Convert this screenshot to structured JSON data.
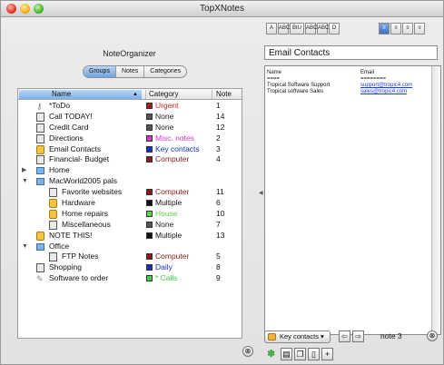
{
  "window": {
    "title": "TopXNotes"
  },
  "left": {
    "app_name": "NoteOrganizer",
    "tabs": [
      "Groups",
      "Notes",
      "Categories"
    ],
    "active_tab": "Groups",
    "columns": {
      "name": "Name",
      "category": "Category",
      "note": "Note"
    },
    "rows": [
      {
        "indent": 0,
        "tri": "",
        "icon": "key-icon",
        "label": "*ToDo",
        "category": "Urgent",
        "cat_color": "#9b1d1d",
        "cat_text_color": "#c0282d",
        "note": "1"
      },
      {
        "indent": 0,
        "tri": "",
        "icon": "note-icon",
        "label": "Call TODAY!",
        "category": "None",
        "cat_color": "#555555",
        "cat_text_color": "#222222",
        "note": "14"
      },
      {
        "indent": 0,
        "tri": "",
        "icon": "note-icon",
        "label": "Credit Card",
        "category": "None",
        "cat_color": "#555555",
        "cat_text_color": "#222222",
        "note": "12"
      },
      {
        "indent": 0,
        "tri": "",
        "icon": "note-icon",
        "label": "Directions",
        "category": "Misc. notes",
        "cat_color": "#d238c4",
        "cat_text_color": "#d238c4",
        "note": "2"
      },
      {
        "indent": 0,
        "tri": "",
        "icon": "flag-icon",
        "label": "Email Contacts",
        "category": "Key contacts",
        "cat_color": "#1b2fb8",
        "cat_text_color": "#1b2fb8",
        "note": "3"
      },
      {
        "indent": 0,
        "tri": "",
        "icon": "note-icon",
        "label": "Financial- Budget",
        "category": "Computer",
        "cat_color": "#8a1a1a",
        "cat_text_color": "#8a1a1a",
        "note": "4"
      },
      {
        "indent": 0,
        "tri": "▶",
        "icon": "folder-icon",
        "label": "Home",
        "category": "",
        "cat_color": "",
        "cat_text_color": "",
        "note": ""
      },
      {
        "indent": 0,
        "tri": "▼",
        "icon": "folder-icon",
        "label": "MacWorld2005 pals",
        "category": "",
        "cat_color": "",
        "cat_text_color": "",
        "note": ""
      },
      {
        "indent": 1,
        "tri": "",
        "icon": "note-icon",
        "label": "Favorite websites",
        "category": "Computer",
        "cat_color": "#8a1a1a",
        "cat_text_color": "#8a1a1a",
        "note": "11"
      },
      {
        "indent": 1,
        "tri": "",
        "icon": "flag-icon",
        "label": "Hardware",
        "category": "Multiple",
        "cat_color": "#111111",
        "cat_text_color": "#111111",
        "note": "6"
      },
      {
        "indent": 1,
        "tri": "",
        "icon": "flag-icon",
        "label": "Home repairs",
        "category": "House",
        "cat_color": "#5fd146",
        "cat_text_color": "#5fd146",
        "note": "10"
      },
      {
        "indent": 1,
        "tri": "",
        "icon": "note-icon",
        "label": "Miscellaneous",
        "category": "None",
        "cat_color": "#555555",
        "cat_text_color": "#222222",
        "note": "7"
      },
      {
        "indent": 0,
        "tri": "",
        "icon": "flag-icon",
        "label": "NOTE THIS!",
        "category": "Multiple",
        "cat_color": "#111111",
        "cat_text_color": "#111111",
        "note": "13"
      },
      {
        "indent": 0,
        "tri": "▼",
        "icon": "folder-icon",
        "label": "Office",
        "category": "",
        "cat_color": "",
        "cat_text_color": "",
        "note": ""
      },
      {
        "indent": 1,
        "tri": "",
        "icon": "note-icon",
        "label": "FTP Notes",
        "category": "Computer",
        "cat_color": "#8a1a1a",
        "cat_text_color": "#8a1a1a",
        "note": "5"
      },
      {
        "indent": 0,
        "tri": "",
        "icon": "note-icon",
        "label": "Shopping",
        "category": "Daily",
        "cat_color": "#1b2fb8",
        "cat_text_color": "#1b2fb8",
        "note": "8"
      },
      {
        "indent": 0,
        "tri": "",
        "icon": "pen-icon",
        "label": "Software to order",
        "category": "* Calls",
        "cat_color": "#3ecf4a",
        "cat_text_color": "#3ecf4a",
        "note": "9"
      }
    ]
  },
  "right": {
    "toolbar_buttons": [
      "A",
      "ABC",
      "BIU",
      "ABC",
      "ABC",
      "D"
    ],
    "align_buttons": [
      "align-left",
      "align-center",
      "align-right",
      "align-justify"
    ],
    "note_title": "Email Contacts",
    "doc_rows": [
      {
        "c1": "Name",
        "c2": "Email",
        "link": false
      },
      {
        "c1": "====",
        "c2": "========",
        "link": false
      },
      {
        "c1": "Tropical Software Support",
        "c2": "support@tropic4.com",
        "link": true
      },
      {
        "c1": "Tropical software Sales",
        "c2": "sales@tropic4.com",
        "link": true
      }
    ],
    "category_popup": "Key contacts ▾",
    "note_indicator": "note 3"
  }
}
